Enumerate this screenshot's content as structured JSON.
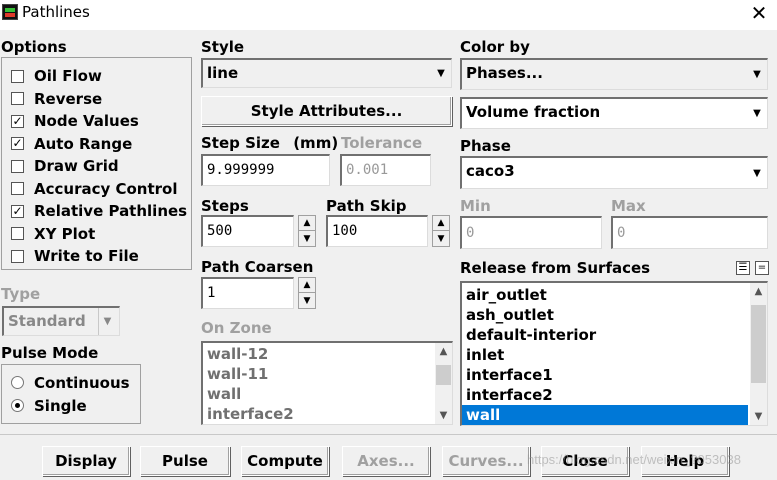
{
  "window": {
    "title": "Pathlines"
  },
  "options": {
    "label": "Options",
    "items": [
      {
        "label": "Oil Flow",
        "checked": false
      },
      {
        "label": "Reverse",
        "checked": false
      },
      {
        "label": "Node Values",
        "checked": true
      },
      {
        "label": "Auto Range",
        "checked": true
      },
      {
        "label": "Draw Grid",
        "checked": false
      },
      {
        "label": "Accuracy Control",
        "checked": false
      },
      {
        "label": "Relative Pathlines",
        "checked": true
      },
      {
        "label": "XY Plot",
        "checked": false
      },
      {
        "label": "Write to File",
        "checked": false
      }
    ]
  },
  "type": {
    "label": "Type",
    "value": "Standard"
  },
  "pulse_mode": {
    "label": "Pulse Mode",
    "options": [
      {
        "label": "Continuous",
        "selected": false
      },
      {
        "label": "Single",
        "selected": true
      }
    ]
  },
  "style": {
    "label": "Style",
    "value": "line",
    "attributes_button": "Style Attributes...",
    "step_size_label": "Step Size",
    "step_size_unit": "(mm)",
    "step_size_value": "9.999999",
    "tolerance_label": "Tolerance",
    "tolerance_value": "0.001",
    "steps_label": "Steps",
    "steps_value": "500",
    "path_skip_label": "Path Skip",
    "path_skip_value": "100",
    "path_coarsen_label": "Path Coarsen",
    "path_coarsen_value": "1",
    "on_zone_label": "On Zone",
    "on_zone_items": [
      "wall-12",
      "wall-11",
      "wall",
      "interface2"
    ]
  },
  "color": {
    "label": "Color by",
    "primary": "Phases...",
    "secondary": "Volume fraction",
    "phase_label": "Phase",
    "phase_value": "caco3",
    "min_label": "Min",
    "min_value": "0",
    "max_label": "Max",
    "max_value": "0"
  },
  "release": {
    "label": "Release from Surfaces",
    "items": [
      {
        "label": "air_outlet",
        "selected": false
      },
      {
        "label": "ash_outlet",
        "selected": false
      },
      {
        "label": "default-interior",
        "selected": false
      },
      {
        "label": "inlet",
        "selected": false
      },
      {
        "label": "interface1",
        "selected": false
      },
      {
        "label": "interface2",
        "selected": false
      },
      {
        "label": "wall",
        "selected": true
      }
    ]
  },
  "buttons": {
    "display": "Display",
    "pulse": "Pulse",
    "compute": "Compute",
    "axes": "Axes...",
    "curves": "Curves...",
    "close": "Close",
    "help": "Help"
  },
  "watermark": "https://blog.csdn.net/weixin_?053038",
  "colors": {
    "selection": "#0078d7",
    "disabled_text": "#a0a0a0"
  }
}
